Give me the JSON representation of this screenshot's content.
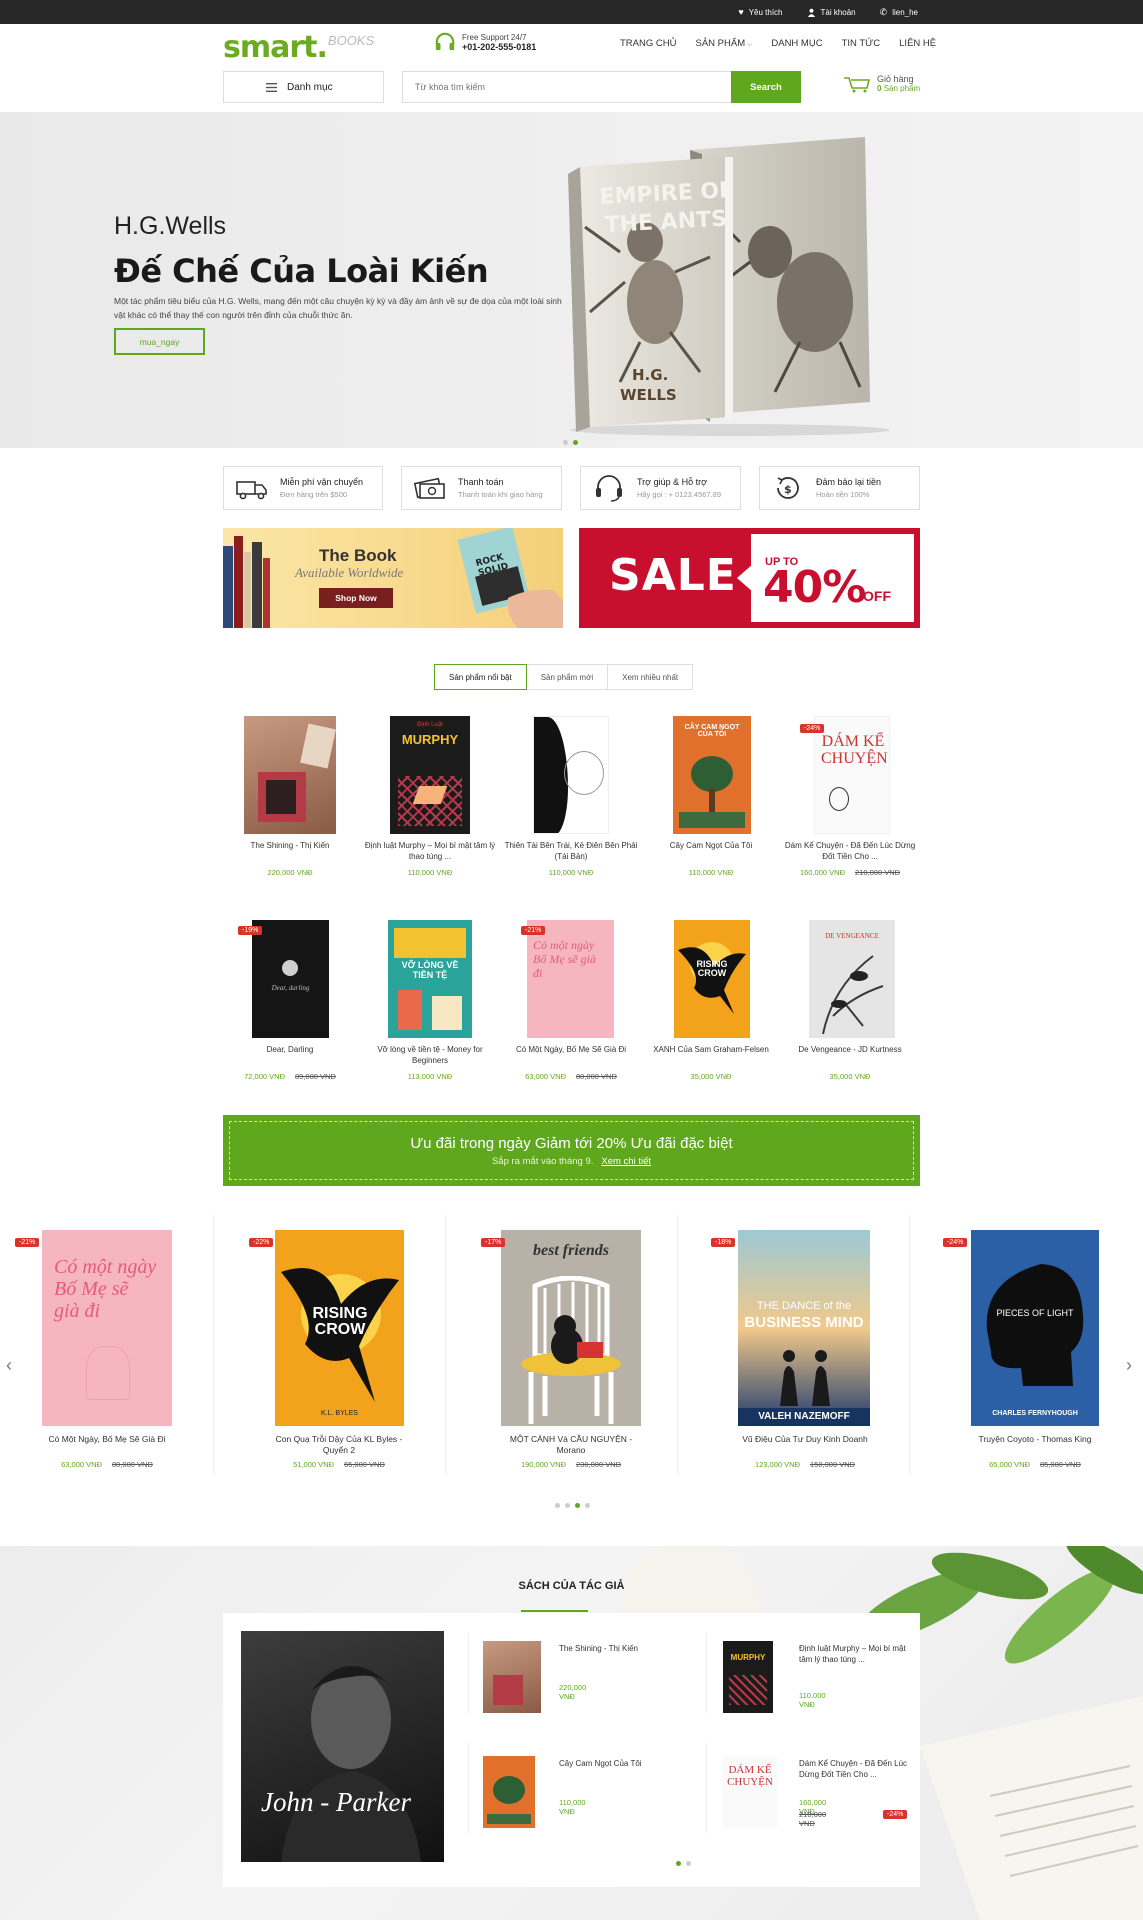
{
  "topbar": {
    "wishlist": "Yêu thích",
    "account": "Tài khoản",
    "contact": "lien_he"
  },
  "header": {
    "logo_main": "smart.",
    "logo_sub": "BOOKS",
    "support_label": "Free Support 24/7",
    "support_phone": "+01-202-555-0181",
    "nav": [
      "TRANG CHỦ",
      "SẢN PHẨM",
      "DANH MỤC",
      "TIN TỨC",
      "LIÊN HỆ"
    ],
    "category_button": "Danh mục",
    "search_placeholder": "Từ khóa tìm kiếm",
    "search_button": "Search",
    "cart_label": "Giỏ hàng",
    "cart_count": "0",
    "cart_unit": "Sản phẩm"
  },
  "hero": {
    "author": "H.G.Wells",
    "title": "Đế Chế Của Loài Kiến",
    "description": "Một tác phẩm tiêu biểu của H.G. Wells, mang đến một câu chuyện kỳ kỳ và đầy ám ảnh về sự đe dọa của một loài sinh vật khác có thể thay thế con người trên đỉnh của chuỗi thức ăn.",
    "button": "mua_ngay",
    "book_title": "EMPIRE OF THE ANTS",
    "book_author": "H.G. WELLS",
    "slides_total": 2,
    "slide_active": 2
  },
  "features": [
    {
      "title": "Miễn phí vận chuyển",
      "sub": "Đơn hàng trên $500",
      "icon": "truck-icon"
    },
    {
      "title": "Thanh toán",
      "sub": "Thanh toán khi giao hàng",
      "icon": "cash-icon"
    },
    {
      "title": "Trợ giúp & Hỗ trợ",
      "sub": "Hãy gọi : + 0123.4567.89",
      "icon": "headset-icon"
    },
    {
      "title": "Đảm bảo lại tiền",
      "sub": "Hoàn tiền 100%",
      "icon": "refund-icon"
    }
  ],
  "banners": {
    "left_title": "The Book",
    "left_sub": "Available Worldwide",
    "left_button": "Shop Now",
    "left_book": "ROCK SOLID",
    "right_sale": "SALE",
    "right_upto": "UP TO",
    "right_pct": "40%",
    "right_off": "OFF"
  },
  "tabs": [
    "Sản phẩm nổi bật",
    "Sản phẩm mới",
    "Xem nhiều nhất"
  ],
  "currency": "VNĐ",
  "products": [
    {
      "name": "The Shining - Thị Kiến",
      "price": "220,000",
      "old": "",
      "badge": ""
    },
    {
      "name": "Định luật Murphy – Mọi bí mật tâm lý thao túng ...",
      "price": "110,000",
      "old": "",
      "badge": ""
    },
    {
      "name": "Thiên Tài Bên Trái, Kẻ Điên Bên Phải (Tái Bản)",
      "price": "110,000",
      "old": "",
      "badge": ""
    },
    {
      "name": "Cây Cam Ngọt Của Tôi",
      "price": "110,000",
      "old": "",
      "badge": ""
    },
    {
      "name": "Dám Kể Chuyện - Đã Đến Lúc Dừng Đốt Tiền Cho ...",
      "price": "160,000",
      "old": "210,000",
      "badge": "-24%"
    },
    {
      "name": "Dear, Darling",
      "price": "72,000",
      "old": "89,000",
      "badge": "-19%"
    },
    {
      "name": "Vỡ lòng về tiền tệ - Money for Beginners",
      "price": "113,000",
      "old": "",
      "badge": ""
    },
    {
      "name": "Có Một Ngày, Bố Mẹ Sẽ Già Đi",
      "price": "63,000",
      "old": "80,000",
      "badge": "-21%"
    },
    {
      "name": "XANH Của Sam Graham-Felsen",
      "price": "35,000",
      "old": "",
      "badge": ""
    },
    {
      "name": "De Vengeance - JD Kurtness",
      "price": "35,000",
      "old": "",
      "badge": ""
    }
  ],
  "covers": {
    "murphy": "MURPHY",
    "murphy_top": "Định Luật",
    "cam": "CÂY CAM NGỌT CỦA TÔI",
    "dam": "DÁM KỂ CHUYỆN",
    "dear": "Dear, darling",
    "volong": "VỠ LÒNG VỀ TIỀN TỆ",
    "comot": "Có một ngày Bố Mẹ sẽ già đi",
    "rising": "RISING CROW",
    "vengeance": "DE VENGEANCE",
    "best": "best friends",
    "dance1": "THE DANCE of the",
    "dance2": "BUSINESS MIND",
    "dance3": "VALEH NAZEMOFF",
    "pieces": "PIECES OF LIGHT",
    "pieces_author": "CHARLES FERNYHOUGH",
    "crow_author": "K.L. BYLES"
  },
  "promo": {
    "title": "Ưu đãi trong ngày Giảm tới 20% Ưu đãi đặc biệt",
    "sub": "Sắp ra mắt vào tháng 9.",
    "link": "Xem chi tiết"
  },
  "carousel": [
    {
      "name": "Có Một Ngày, Bố Mẹ Sẽ Già Đi",
      "price": "63,000",
      "old": "80,000",
      "badge": "-21%"
    },
    {
      "name": "Con Quạ Trỗi Dậy Của KL Byles - Quyển 2",
      "price": "51,000",
      "old": "65,000",
      "badge": "-22%"
    },
    {
      "name": "MỘT CÁNH Và CẦU NGUYỆN - Morano",
      "price": "190,000",
      "old": "230,000",
      "badge": "-17%"
    },
    {
      "name": "Vũ Điệu Của Tư Duy Kinh Doanh",
      "price": "123,000",
      "old": "150,000",
      "badge": "-18%"
    },
    {
      "name": "Truyện Coyoto - Thomas King",
      "price": "65,000",
      "old": "85,000",
      "badge": "-24%"
    }
  ],
  "carousel_dots": 4,
  "carousel_active": 3,
  "author_section": {
    "title": "SÁCH CỦA TÁC GIẢ",
    "author_name": "John - Parker",
    "items": [
      {
        "name": "The Shining - Thị Kiến",
        "price": "220,000",
        "old": "",
        "badge": ""
      },
      {
        "name": "Định luật Murphy – Mọi bí mật tâm lý thao túng ...",
        "price": "110,000",
        "old": "",
        "badge": ""
      },
      {
        "name": "Cây Cam Ngọt Của Tôi",
        "price": "110,000",
        "old": "",
        "badge": ""
      },
      {
        "name": "Dám Kể Chuyện - Đã Đến Lúc Dừng Đốt Tiền Cho ...",
        "price": "160,000",
        "old": "210,000",
        "badge": "-24%"
      }
    ]
  },
  "colors": {
    "accent": "#5fa81e",
    "sale_red": "#c8102e",
    "badge_red": "#d9342b",
    "topbar": "#272727"
  }
}
